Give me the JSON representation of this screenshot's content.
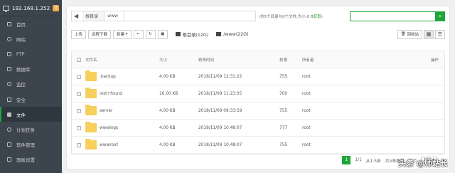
{
  "sidebar": {
    "host": "192.168.1.252",
    "badge": "0",
    "items": [
      {
        "label": "首页",
        "icon": "home-icon"
      },
      {
        "label": "网站",
        "icon": "globe-icon"
      },
      {
        "label": "FTP",
        "icon": "ftp-icon"
      },
      {
        "label": "数据库",
        "icon": "database-icon"
      },
      {
        "label": "监控",
        "icon": "monitor-icon"
      },
      {
        "label": "安全",
        "icon": "shield-icon"
      },
      {
        "label": "文件",
        "icon": "folder-icon",
        "active": true
      },
      {
        "label": "计划任务",
        "icon": "clock-icon"
      },
      {
        "label": "软件管理",
        "icon": "apps-icon"
      },
      {
        "label": "面板设置",
        "icon": "settings-icon"
      }
    ]
  },
  "pathbar": {
    "crumbs": [
      "根目录",
      "www"
    ],
    "info_prefix": "(共5个目录与0个文件,大小:0 B",
    "info_link": "获取",
    "info_suffix": ")"
  },
  "search": {
    "placeholder": ""
  },
  "toolbar": {
    "upload": "上传",
    "remote_download": "远程下载",
    "new": "新建",
    "disks": [
      {
        "label": "根目录(12G)"
      },
      {
        "label": "/www(22G)"
      }
    ],
    "recycle": "回收站"
  },
  "table": {
    "headers": {
      "name": "文件名",
      "size": "大小",
      "time": "修改时间",
      "perm": "权限",
      "owner": "所有者",
      "op": "操作"
    },
    "rows": [
      {
        "name": ".backup",
        "size": "4.00 KB",
        "time": "2018/11/09 12:31:22",
        "perm": "755",
        "owner": "root"
      },
      {
        "name": "lost+found",
        "size": "16.00 KB",
        "time": "2018/11/09 11:23:05",
        "perm": "700",
        "owner": "root"
      },
      {
        "name": "server",
        "size": "4.00 KB",
        "time": "2018/11/09 09:33:59",
        "perm": "755",
        "owner": "root"
      },
      {
        "name": "wwwlogs",
        "size": "4.00 KB",
        "time": "2018/11/09 10:48:07",
        "perm": "777",
        "owner": "root"
      },
      {
        "name": "wwwroot",
        "size": "4.00 KB",
        "time": "2018/11/09 10:48:07",
        "perm": "755",
        "owner": "root"
      }
    ]
  },
  "pager": {
    "current": "1",
    "total": "1/1",
    "range": "从1-5条",
    "count": "共5条数据",
    "per_page_label": "每页",
    "per_page": "100",
    "unit": "条"
  },
  "watermark": "头条 @师站长",
  "colors": {
    "accent": "#20a53a",
    "sidebar": "#3c444d",
    "folder": "#f6cf5d"
  }
}
